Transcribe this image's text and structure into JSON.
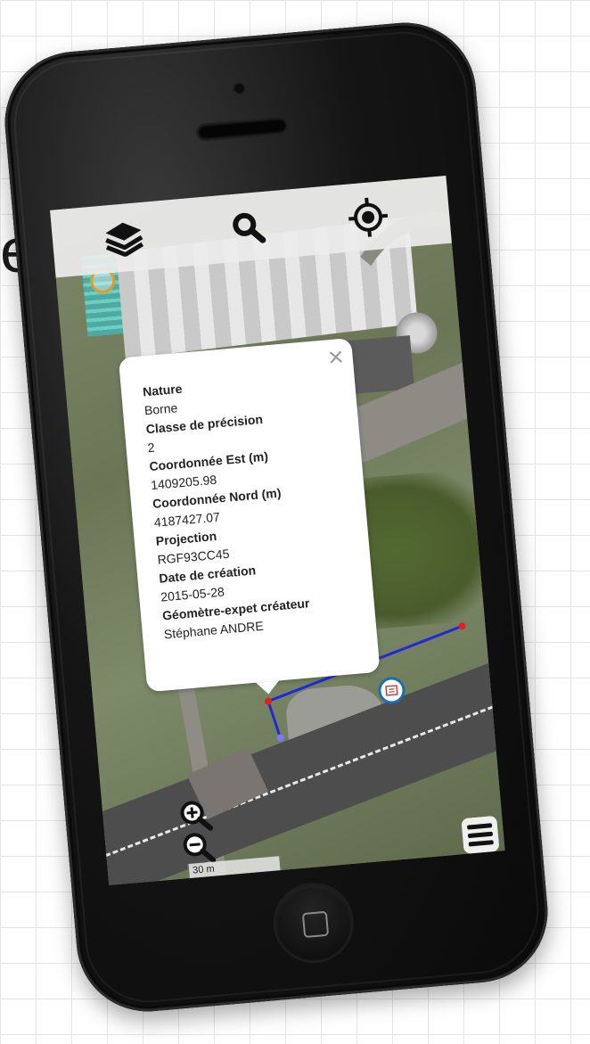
{
  "toolbar": {
    "layers_icon": "layers-icon",
    "search_icon": "search-icon",
    "locate_icon": "crosshair-icon"
  },
  "popup": {
    "close_label": "×",
    "attributes": [
      {
        "label": "Nature",
        "value": "Borne"
      },
      {
        "label": "Classe de précision",
        "value": "2"
      },
      {
        "label": "Coordonnée Est (m)",
        "value": "1409205.98"
      },
      {
        "label": "Coordonnée Nord (m)",
        "value": "4187427.07"
      },
      {
        "label": "Projection",
        "value": "RGF93CC45"
      },
      {
        "label": "Date de création",
        "value": "2015-05-28"
      },
      {
        "label": "Géomètre-expet créateur",
        "value": "Stéphane ANDRE"
      }
    ]
  },
  "map": {
    "scale_label": "30 m",
    "line_color": "#1f2bd6",
    "vertex_color": "#e0221c",
    "marker_color": "#1b6fb0"
  },
  "background": {
    "partial_text": "e"
  }
}
